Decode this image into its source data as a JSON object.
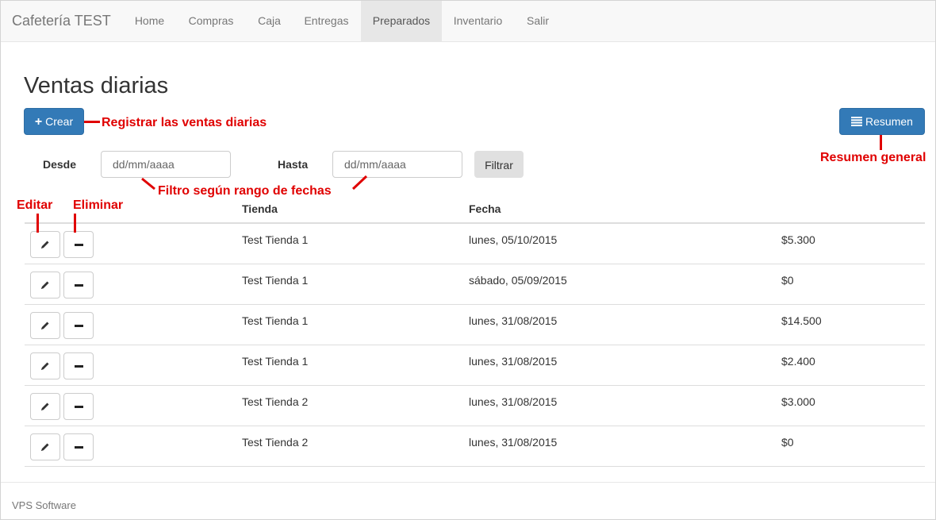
{
  "navbar": {
    "brand": "Cafetería TEST",
    "items": [
      {
        "label": "Home",
        "active": false
      },
      {
        "label": "Compras",
        "active": false
      },
      {
        "label": "Caja",
        "active": false
      },
      {
        "label": "Entregas",
        "active": false
      },
      {
        "label": "Preparados",
        "active": true
      },
      {
        "label": "Inventario",
        "active": false
      },
      {
        "label": "Salir",
        "active": false
      }
    ]
  },
  "page": {
    "title": "Ventas diarias",
    "crear_label": "Crear",
    "resumen_label": "Resumen"
  },
  "filter": {
    "desde_label": "Desde",
    "hasta_label": "Hasta",
    "desde_placeholder": "dd/mm/aaaa",
    "hasta_placeholder": "dd/mm/aaaa",
    "filtrar_label": "Filtrar"
  },
  "table": {
    "headers": {
      "tienda": "Tienda",
      "fecha": "Fecha"
    },
    "rows": [
      {
        "tienda": "Test Tienda 1",
        "fecha": "lunes, 05/10/2015",
        "monto": "$5.300"
      },
      {
        "tienda": "Test Tienda 1",
        "fecha": "sábado, 05/09/2015",
        "monto": "$0"
      },
      {
        "tienda": "Test Tienda 1",
        "fecha": "lunes, 31/08/2015",
        "monto": "$14.500"
      },
      {
        "tienda": "Test Tienda 1",
        "fecha": "lunes, 31/08/2015",
        "monto": "$2.400"
      },
      {
        "tienda": "Test Tienda 2",
        "fecha": "lunes, 31/08/2015",
        "monto": "$3.000"
      },
      {
        "tienda": "Test Tienda 2",
        "fecha": "lunes, 31/08/2015",
        "monto": "$0"
      }
    ]
  },
  "annotations": {
    "registrar": "Registrar las ventas diarias",
    "resumen_general": "Resumen general",
    "filtro": "Filtro según rango de fechas",
    "editar": "Editar",
    "eliminar": "Eliminar"
  },
  "footer": {
    "text": "VPS Software"
  },
  "colors": {
    "primary": "#337ab7",
    "annotation": "#e00000",
    "navbar_bg": "#f8f8f8"
  }
}
